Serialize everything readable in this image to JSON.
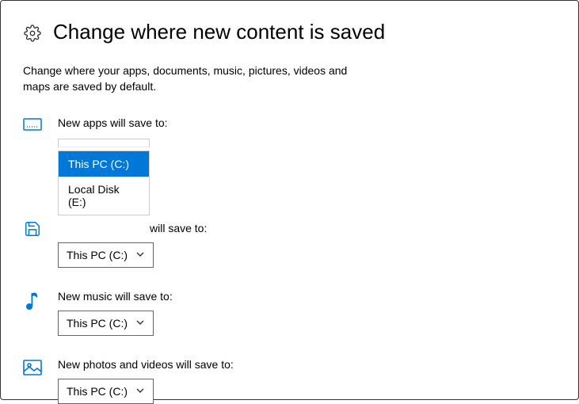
{
  "header": {
    "title": "Change where new content is saved"
  },
  "description": "Change where your apps, documents, music, pictures, videos and maps are saved by default.",
  "apps": {
    "label": "New apps will save to:",
    "options": {
      "selected": "This PC (C:)",
      "other": "Local Disk (E:)"
    }
  },
  "docs": {
    "label_peek": "will save to:",
    "value": "This PC (C:)"
  },
  "music": {
    "label": "New music will save to:",
    "value": "This PC (C:)"
  },
  "photos": {
    "label": "New photos and videos will save to:",
    "value": "This PC (C:)"
  }
}
